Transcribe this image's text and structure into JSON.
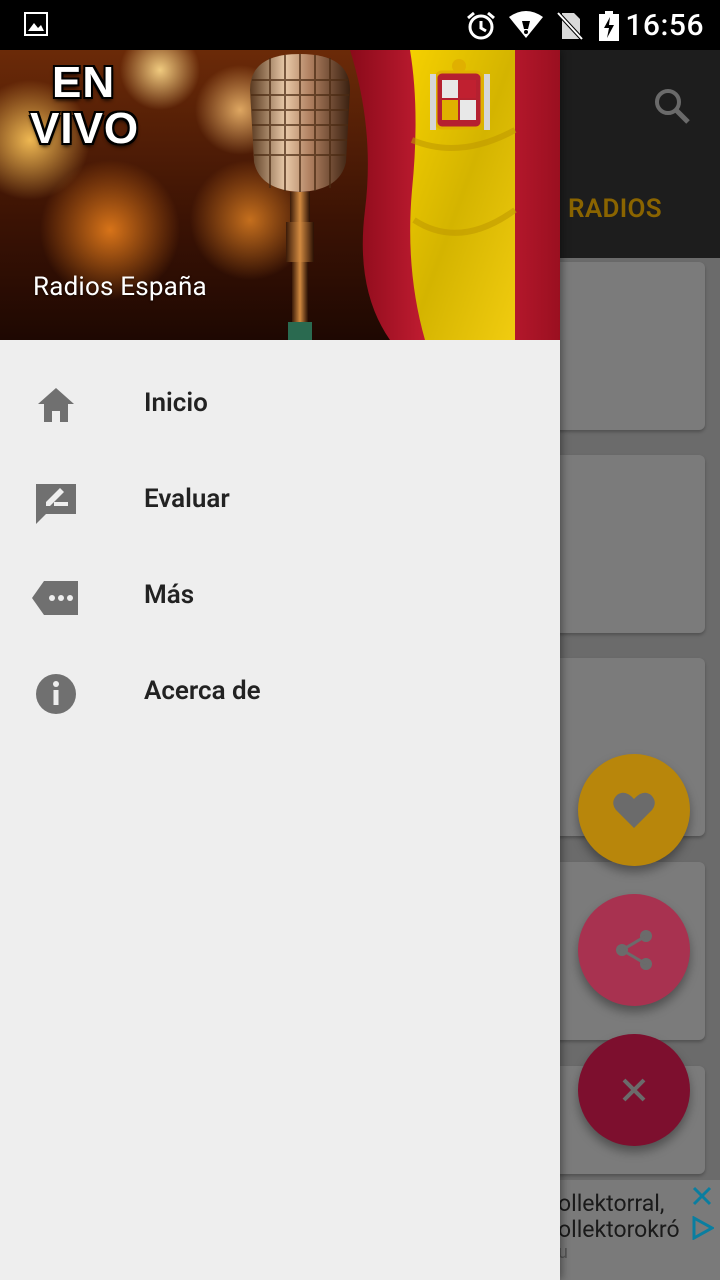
{
  "status_bar": {
    "time": "16:56",
    "icons": [
      "image-notification-icon",
      "alarm-icon",
      "wifi-icon",
      "no-sim-icon",
      "battery-charging-icon"
    ]
  },
  "background_app": {
    "tab_label": "RADIOS",
    "search_icon": "search-icon",
    "fab_icons": [
      "heart-icon",
      "share-icon",
      "close-icon"
    ],
    "colors": {
      "fab_favorite": "#b8860b",
      "fab_share": "#a83250",
      "fab_close": "#7d0f2e",
      "tab_text": "#8a6400"
    },
    "ad": {
      "lines": [
        "ollektorral,",
        "ollektorokró",
        "u"
      ]
    }
  },
  "drawer": {
    "header_badge": [
      "EN",
      "VIVO"
    ],
    "header_title": "Radios España",
    "items": [
      {
        "label": "Inicio",
        "icon": "home-icon"
      },
      {
        "label": "Evaluar",
        "icon": "rate-review-icon"
      },
      {
        "label": "Más",
        "icon": "more-icon"
      },
      {
        "label": "Acerca de",
        "icon": "info-icon"
      }
    ]
  }
}
